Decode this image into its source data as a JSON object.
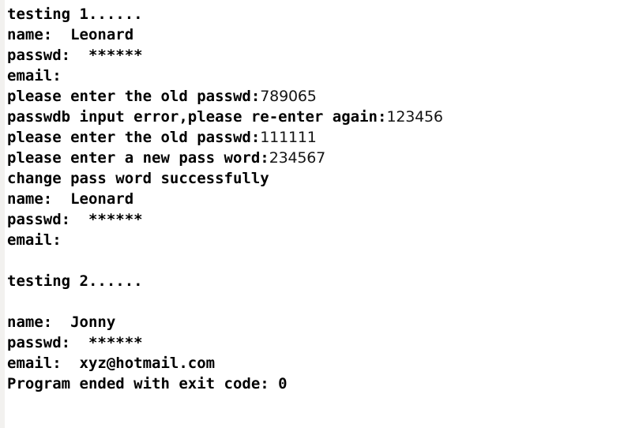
{
  "console": {
    "background_color": "#ffffff",
    "text_color": "#000000",
    "gutter_color": "#f2f1ef",
    "lines": [
      {
        "id": "line-testing-1",
        "out": "testing 1......",
        "typed": ""
      },
      {
        "id": "line-name-1",
        "out": "name:  Leonard",
        "typed": ""
      },
      {
        "id": "line-passwd-1",
        "out": "passwd:  ******",
        "typed": ""
      },
      {
        "id": "line-email-1",
        "out": "email:",
        "typed": ""
      },
      {
        "id": "line-prompt-old-passwd-1",
        "out": "please enter the old passwd:",
        "typed": "789065"
      },
      {
        "id": "line-input-error",
        "out": "passwdb input error,please re-enter again:",
        "typed": "123456"
      },
      {
        "id": "line-prompt-old-passwd-2",
        "out": "please enter the old passwd:",
        "typed": "111111"
      },
      {
        "id": "line-prompt-new-passwd",
        "out": "please enter a new pass word:",
        "typed": "234567"
      },
      {
        "id": "line-change-success",
        "out": "change pass word successfully",
        "typed": ""
      },
      {
        "id": "line-name-2",
        "out": "name:  Leonard",
        "typed": ""
      },
      {
        "id": "line-passwd-2",
        "out": "passwd:  ******",
        "typed": ""
      },
      {
        "id": "line-email-2",
        "out": "email:",
        "typed": ""
      },
      {
        "id": "line-blank-1",
        "out": "",
        "typed": ""
      },
      {
        "id": "line-testing-2",
        "out": "testing 2......",
        "typed": ""
      },
      {
        "id": "line-blank-2",
        "out": "",
        "typed": ""
      },
      {
        "id": "line-name-3",
        "out": "name:  Jonny",
        "typed": ""
      },
      {
        "id": "line-passwd-3",
        "out": "passwd:  ******",
        "typed": ""
      },
      {
        "id": "line-email-3",
        "out": "email:  xyz@hotmail.com",
        "typed": ""
      },
      {
        "id": "line-program-ended",
        "out": "Program ended with exit code: 0",
        "typed": ""
      }
    ]
  }
}
